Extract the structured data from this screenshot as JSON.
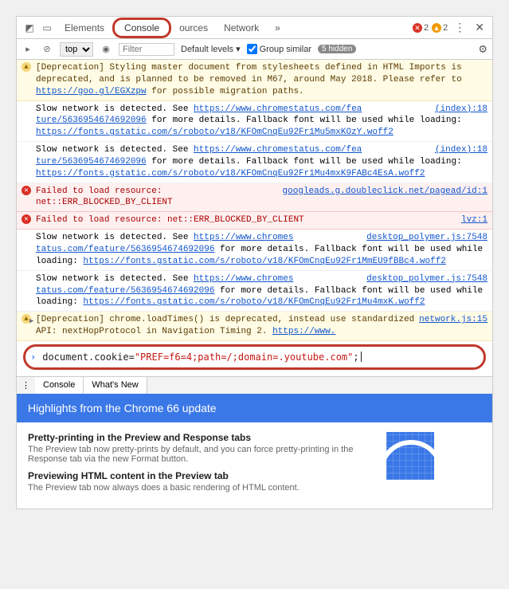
{
  "topbar": {
    "tabs": {
      "elements": "Elements",
      "console": "Console",
      "sources": "ources",
      "network": "Network",
      "more": "»"
    },
    "errors": "2",
    "warnings": "2"
  },
  "filterbar": {
    "context": "top",
    "filter_placeholder": "Filter",
    "default_levels": "Default levels ▾",
    "group_similar": "Group similar",
    "hidden": "5 hidden"
  },
  "messages": {
    "m1": "[Deprecation] Styling master document from stylesheets defined in HTML Imports is deprecated, and is planned to be removed in M67, around May 2018. Please refer to ",
    "m1_link": "https://goo.gl/EGXzpw",
    "m1_after": " for possible migration paths.",
    "m2_a": "Slow network is detected. See ",
    "m2_link1": "https://www.chromestatus.com/fea",
    "m2_src1": "(index):18",
    "m2_b": "ture/5636954674692096",
    "m2_c": " for more details. Fallback font will be used while loading: ",
    "m2_link2": "https://fonts.gstatic.com/s/roboto/v18/KFOmCnqEu92Fr1Mu5mxKOzY.woff2",
    "m3_a": "Slow network is detected. See ",
    "m3_link1": "https://www.chromestatus.com/fea",
    "m3_src1": "(index):18",
    "m3_b": "ture/5636954674692096",
    "m3_c": " for more details. Fallback font will be used while loading: ",
    "m3_link2": "https://fonts.gstatic.com/s/roboto/v18/KFOmCnqEu92Fr1Mu4mxK9FABc4EsA.woff2",
    "e1_text": "Failed to load resource: net::ERR_BLOCKED_BY_CLIENT",
    "e1_src": "googleads.g.doubleclick.net/pagead/id:1",
    "e2_text": "Failed to load resource: net::ERR_BLOCKED_BY_CLIENT",
    "e2_src": "lvz:1",
    "m4_a": "Slow network is detected. See ",
    "m4_link1": "https://www.chromes",
    "m4_src1": "desktop_polymer.js:7548",
    "m4_b": "tatus.com/feature/5636954674692096",
    "m4_c": " for more details. Fallback font will be used while loading: ",
    "m4_link2": "https://fonts.gstatic.com/s/roboto/v18/KFOmCnqEu92Fr1MmEU9fBBc4.woff2",
    "m5_a": "Slow network is detected. See ",
    "m5_link1": "https://www.chromes",
    "m5_src1": "desktop_polymer.js:7548",
    "m5_b": "tatus.com/feature/5636954674692096",
    "m5_c": " for more details. Fallback font will be used while loading: ",
    "m5_link2": "https://fonts.gstatic.com/s/roboto/v18/KFOmCnqEu92Fr1Mu4mxK.woff2",
    "w2": "[Deprecation] chrome.loadTimes() is deprecated, instead use standardized API: nextHopProtocol in Navigation Timing 2. ",
    "w2_link": "https://www.",
    "w2_src": "network.js:15"
  },
  "input": {
    "pre": "document.cookie=",
    "str": "\"PREF=f6=4;path=/;domain=.youtube.com\"",
    "post": ";"
  },
  "drawer": {
    "console_tab": "Console",
    "whatsnew_tab": "What's New"
  },
  "highlights": {
    "title": "Highlights from the Chrome 66 update"
  },
  "whatsnew": {
    "h1": "Pretty-printing in the Preview and Response tabs",
    "p1": "The Preview tab now pretty-prints by default, and you can force pretty-printing in the Response tab via the new Format button.",
    "h2": "Previewing HTML content in the Preview tab",
    "p2": "The Preview tab now always does a basic rendering of HTML content."
  }
}
